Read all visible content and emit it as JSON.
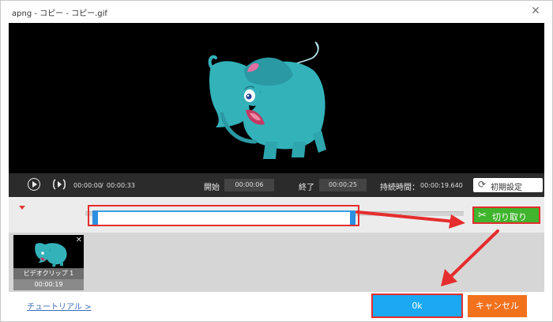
{
  "window": {
    "title": "apng - コピー - コピー.gif",
    "close_icon": "close-icon"
  },
  "player": {
    "current_time": "00:00:00",
    "separator": "/",
    "total_time": "00:00:33",
    "start_label": "開始",
    "start_value": "00:00:06",
    "end_label": "終了",
    "end_value": "00:00:25",
    "duration_label": "持続時間：",
    "duration_value": "00:00:19.640",
    "reset_label": "初期設定",
    "reset_icon": "refresh-icon"
  },
  "timeline": {
    "cut_label": "切り取り",
    "cut_icon": "scissors-icon"
  },
  "clip": {
    "name": "ビデオクリップ 1",
    "duration": "00:00:19"
  },
  "footer": {
    "tutorial_link": "チュートリアル >",
    "ok_label": "0k",
    "cancel_label": "キャンセル"
  },
  "colors": {
    "highlight": "#e52d2d",
    "ok": "#1aa9f2",
    "cancel": "#f2711d",
    "cut": "#3fb42c",
    "elephant": "#33b2ba"
  }
}
